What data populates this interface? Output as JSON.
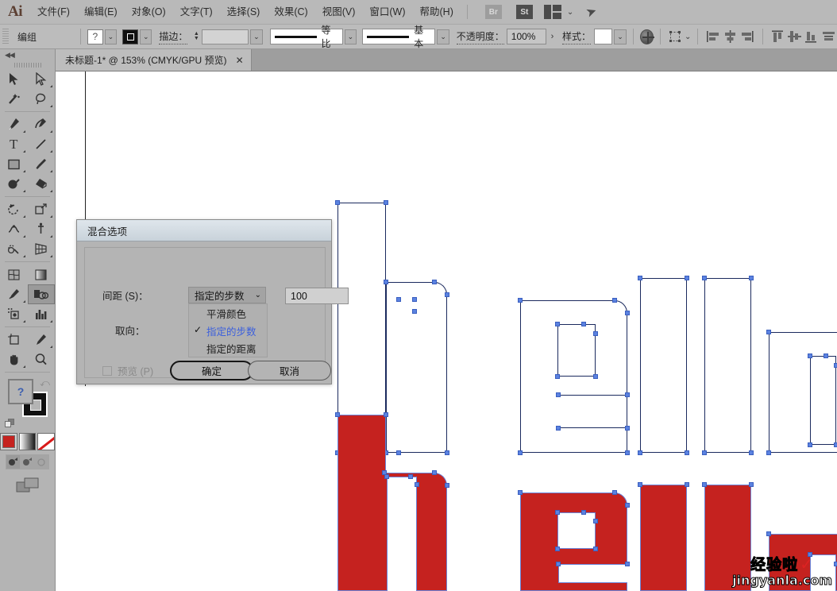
{
  "app": {
    "name": "Ai",
    "logo_label": "Ai"
  },
  "menubar": {
    "items": [
      {
        "label": "文件(F)",
        "name": "menu-file"
      },
      {
        "label": "编辑(E)",
        "name": "menu-edit"
      },
      {
        "label": "对象(O)",
        "name": "menu-object"
      },
      {
        "label": "文字(T)",
        "name": "menu-type"
      },
      {
        "label": "选择(S)",
        "name": "menu-select"
      },
      {
        "label": "效果(C)",
        "name": "menu-effect"
      },
      {
        "label": "视图(V)",
        "name": "menu-view"
      },
      {
        "label": "窗口(W)",
        "name": "menu-window"
      },
      {
        "label": "帮助(H)",
        "name": "menu-help"
      }
    ],
    "bridge_badge": "Br",
    "stock_badge": "St",
    "workspace_chevron": "⌄",
    "rocket": "➤"
  },
  "controlbar": {
    "selection_label": "编组",
    "fill_swatch_glyph": "?",
    "stroke_label": "描边：",
    "stroke_weight_value": "",
    "profile_label": "等比",
    "brush_label": "基本",
    "opacity_label": "不透明度：",
    "opacity_value": "100%",
    "opacity_arrow": "›",
    "style_label": "样式：",
    "dropdown_chevron": "⌄",
    "align_icons": [
      "align-left-icon",
      "align-center-horizontal-icon",
      "align-right-icon",
      "align-top-icon",
      "align-center-vertical-icon",
      "align-bottom-icon",
      "distribute-icon"
    ]
  },
  "tabbar": {
    "document_title": "未标题-1* @ 153% (CMYK/GPU 预览)",
    "close_glyph": "✕"
  },
  "toolpanel": {
    "collapse_glyph": "◀◀",
    "tools": [
      {
        "name": "selection-tool",
        "glyph": "➤",
        "selected": false
      },
      {
        "name": "direct-selection-tool",
        "glyph": "➢",
        "selected": false
      },
      {
        "name": "magic-wand-tool",
        "glyph": "✨",
        "selected": false
      },
      {
        "name": "lasso-tool",
        "glyph": "◠",
        "selected": false
      },
      {
        "name": "pen-tool",
        "glyph": "✒",
        "selected": false
      },
      {
        "name": "curvature-tool",
        "glyph": "✎",
        "selected": false
      },
      {
        "name": "type-tool",
        "glyph": "T",
        "selected": false
      },
      {
        "name": "line-segment-tool",
        "glyph": "╱",
        "selected": false
      },
      {
        "name": "rectangle-tool",
        "glyph": "▣",
        "selected": false
      },
      {
        "name": "paintbrush-tool",
        "glyph": "🖌",
        "selected": false
      },
      {
        "name": "shaper-tool",
        "glyph": "◑",
        "selected": false
      },
      {
        "name": "eraser-tool",
        "glyph": "◆",
        "selected": false
      },
      {
        "name": "rotate-tool",
        "glyph": "↻",
        "selected": false
      },
      {
        "name": "scale-tool",
        "glyph": "⤢",
        "selected": false
      },
      {
        "name": "width-tool",
        "glyph": "⧓",
        "selected": false
      },
      {
        "name": "free-transform-tool",
        "glyph": "✛",
        "selected": false
      },
      {
        "name": "shape-builder-tool",
        "glyph": "◌",
        "selected": false
      },
      {
        "name": "perspective-grid-tool",
        "glyph": "▦",
        "selected": false
      },
      {
        "name": "mesh-tool",
        "glyph": "▩",
        "selected": false
      },
      {
        "name": "gradient-tool",
        "glyph": "▤",
        "selected": false
      },
      {
        "name": "eyedropper-tool",
        "glyph": "⚲",
        "selected": false
      },
      {
        "name": "blend-tool",
        "glyph": "◕",
        "selected": true
      },
      {
        "name": "symbol-sprayer-tool",
        "glyph": "⁘",
        "selected": false
      },
      {
        "name": "column-graph-tool",
        "glyph": "▥",
        "selected": false
      },
      {
        "name": "artboard-tool",
        "glyph": "⬓",
        "selected": false
      },
      {
        "name": "slice-tool",
        "glyph": "✎",
        "selected": false
      },
      {
        "name": "hand-tool",
        "glyph": "✋",
        "selected": false
      },
      {
        "name": "zoom-tool",
        "glyph": "⚲",
        "selected": false
      }
    ],
    "fill_glyph": "?",
    "swap_glyph": "⤺",
    "color_modes": [
      "solid-color-icon",
      "gradient-icon",
      "none-icon"
    ],
    "draw_modes": [
      "draw-normal-icon",
      "draw-behind-icon",
      "draw-inside-icon"
    ],
    "screen_mode_icon": "screen-mode-icon",
    "fill_color": "#c5221f"
  },
  "dialog": {
    "title": "混合选项",
    "spacing_label": "间距 (S)：",
    "spacing_value": "指定的步数",
    "steps_value": "100",
    "orientation_label": "取向：",
    "dropdown_options": [
      {
        "label": "平滑颜色",
        "checked": false
      },
      {
        "label": "指定的步数",
        "checked": true
      },
      {
        "label": "指定的距离",
        "checked": false
      }
    ],
    "check_glyph": "✓",
    "preview_label": "预览 (P)",
    "ok_label": "确定",
    "cancel_label": "取消"
  },
  "canvas": {
    "text_content": "hello",
    "outline_stroke_color": "#1b2a5e",
    "anchor_color": "#5b82e0",
    "fill_color": "#c5221f",
    "top_row_note": "hello (outlined / unfilled blend source)",
    "bottom_row_note": "hello (red filled blend source)"
  },
  "watermark": {
    "line1": "经验啦",
    "check": "✓",
    "line2": "jingyanla.com"
  }
}
